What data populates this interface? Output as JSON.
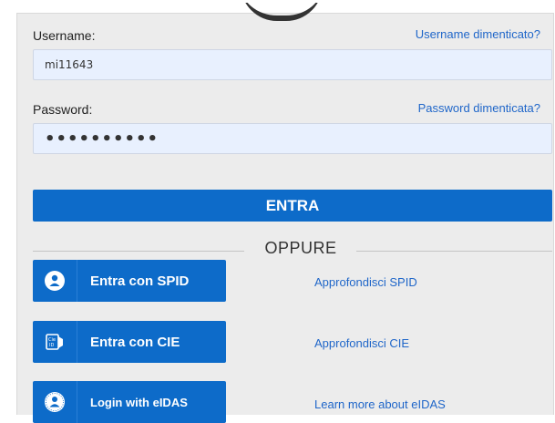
{
  "username": {
    "label": "Username:",
    "forgot_link": "Username dimenticato?",
    "value": "mi11643"
  },
  "password": {
    "label": "Password:",
    "forgot_link": "Password dimenticata?",
    "value": "••••••••••"
  },
  "submit_label": "ENTRA",
  "separator": "OPPURE",
  "alt_logins": [
    {
      "label": "Entra con SPID",
      "icon": "user-icon",
      "link": "Approfondisci SPID"
    },
    {
      "label": "Entra con CIE",
      "icon": "cie-id-card-icon",
      "link": "Approfondisci CIE"
    },
    {
      "label": "Login with eIDAS",
      "icon": "eidas-user-icon",
      "link": "Learn more about eIDAS"
    }
  ],
  "colors": {
    "primary": "#0d6bc9",
    "link": "#1f66c9",
    "panel_bg": "#ececec",
    "field_bg": "#e8f0fe"
  }
}
